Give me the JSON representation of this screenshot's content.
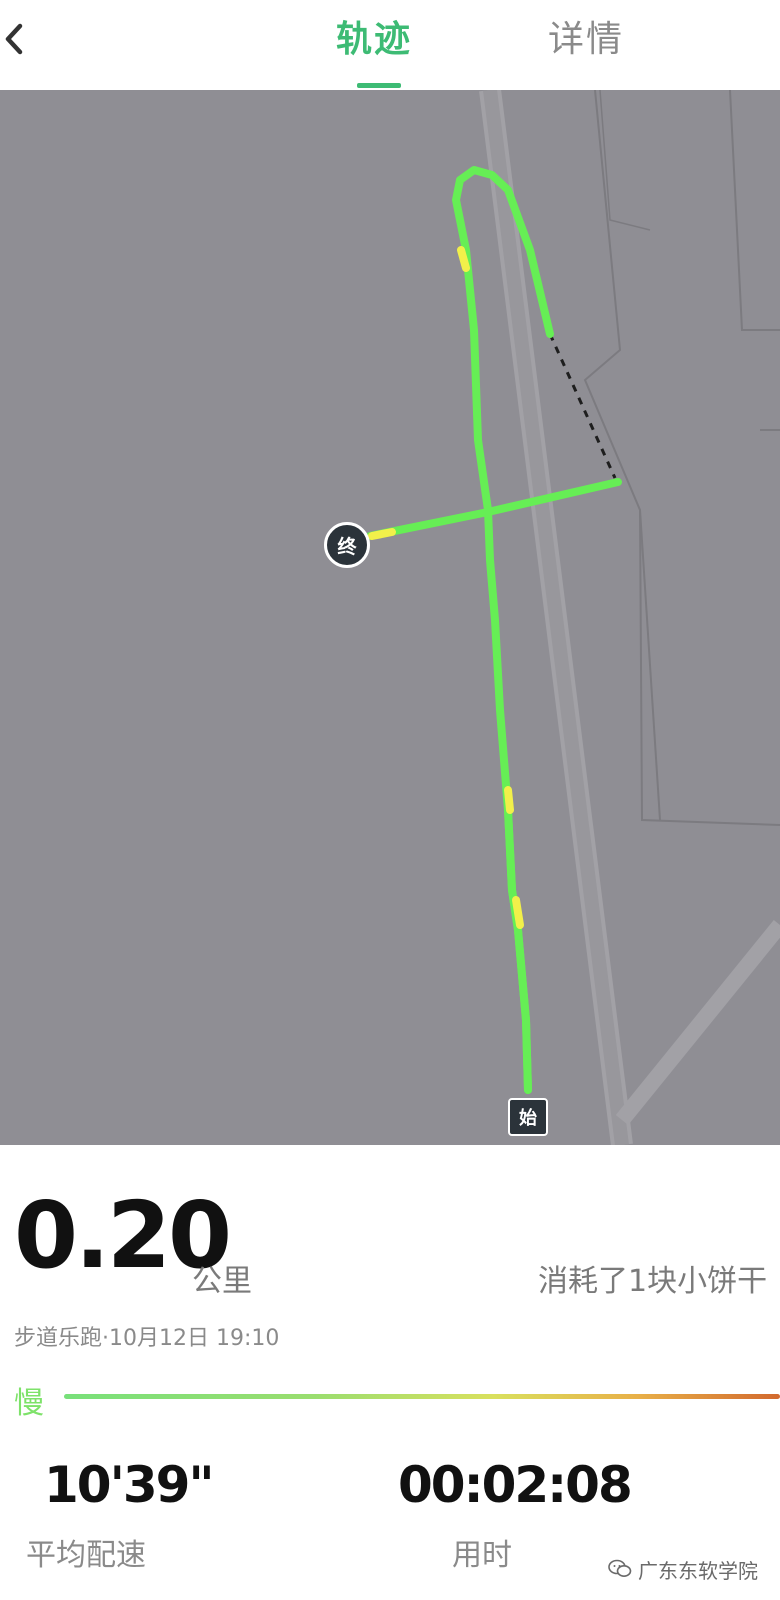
{
  "header": {
    "tabs": [
      {
        "label": "轨迹",
        "active": true
      },
      {
        "label": "详情",
        "active": false
      }
    ],
    "back_icon": "chevron-left-icon"
  },
  "map": {
    "end_marker": "终",
    "start_marker": "始",
    "track_color": "#66ee55",
    "slow_color": "#f2f04a",
    "background_color": "#8f8e94"
  },
  "summary": {
    "distance": "0.20",
    "distance_unit": "公里",
    "calories": "消耗了1块小饼干",
    "meta": "步道乐跑·10月12日 19:10",
    "pace_slow_label": "慢"
  },
  "stats": {
    "avg_pace": {
      "value": "10'39\"",
      "label": "平均配速"
    },
    "duration": {
      "value": "00:02:08",
      "label": "用时"
    }
  },
  "watermark": {
    "text": "广东东软学院",
    "icon": "wechat-icon"
  }
}
